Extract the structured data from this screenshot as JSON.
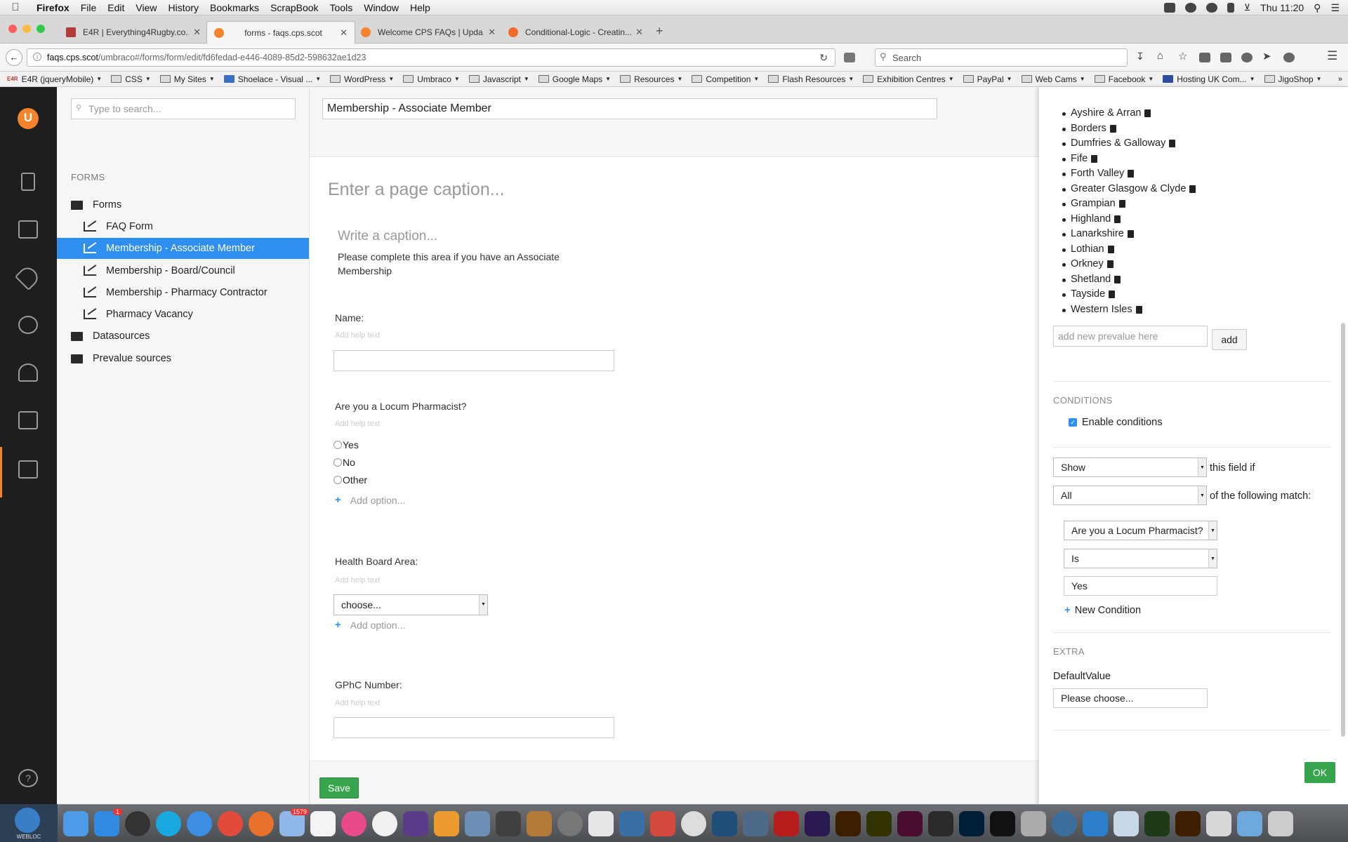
{
  "menubar": {
    "app": "Firefox",
    "items": [
      "File",
      "Edit",
      "View",
      "History",
      "Bookmarks",
      "ScrapBook",
      "Tools",
      "Window",
      "Help"
    ],
    "clock": "Thu 11:20"
  },
  "tabs": [
    {
      "label": "E4R | Everything4Rugby.co...",
      "favicon_color": "#b23b3b"
    },
    {
      "label": "forms - faqs.cps.scot",
      "favicon_color": "#f5832b"
    },
    {
      "label": "Welcome CPS FAQs | Upda...",
      "favicon_color": "#f5832b"
    },
    {
      "label": "Conditional-Logic - Creatin...",
      "favicon_color": "#f26b2b"
    }
  ],
  "url": {
    "host": "faqs.cps.scot",
    "path": "/umbraco#/forms/form/edit/fd6fedad-e446-4089-85d2-598632ae1d23"
  },
  "search_placeholder": "Search",
  "bookmarks": [
    "E4R (jqueryMobile)",
    "CSS",
    "My Sites",
    "Shoelace - Visual ...",
    "WordPress",
    "Umbraco",
    "Javascript",
    "Google Maps",
    "Resources",
    "Competition",
    "Flash Resources",
    "Exhibition Centres",
    "PayPal",
    "Web Cams",
    "Facebook",
    "Hosting UK Com...",
    "JigoShop"
  ],
  "tree": {
    "search_placeholder": "Type to search...",
    "section": "FORMS",
    "nodes": [
      {
        "label": "Forms",
        "type": "folder",
        "level": 0
      },
      {
        "label": "FAQ Form",
        "type": "form",
        "level": 1
      },
      {
        "label": "Membership - Associate Member",
        "type": "form",
        "level": 1,
        "selected": true
      },
      {
        "label": "Membership - Board/Council",
        "type": "form",
        "level": 1
      },
      {
        "label": "Membership - Pharmacy Contractor",
        "type": "form",
        "level": 1
      },
      {
        "label": "Pharmacy Vacancy",
        "type": "form",
        "level": 1
      },
      {
        "label": "Datasources",
        "type": "folder",
        "level": 0
      },
      {
        "label": "Prevalue sources",
        "type": "folder",
        "level": 0
      }
    ]
  },
  "editor": {
    "form_name": "Membership - Associate Member",
    "page_caption_placeholder": "Enter a page caption...",
    "fieldset_caption_placeholder": "Write a caption...",
    "fieldset_description": "Please complete this area if you have an Associate Membership",
    "help_placeholder": "Add help text",
    "add_option": "Add option...",
    "fields": {
      "name_label": "Name:",
      "locum_label": "Are you a Locum Pharmacist?",
      "locum_options": [
        "Yes",
        "No",
        "Other"
      ],
      "health_label": "Health Board Area:",
      "health_select": "choose...",
      "gphc_label": "GPhC Number:"
    },
    "save": "Save"
  },
  "settings": {
    "prevalues": [
      "Ayshire & Arran",
      "Borders",
      "Dumfries & Galloway",
      "Fife",
      "Forth Valley",
      "Greater Glasgow & Clyde",
      "Grampian",
      "Highland",
      "Lanarkshire",
      "Lothian",
      "Orkney",
      "Shetland",
      "Tayside",
      "Western Isles"
    ],
    "prevalue_placeholder": "add new prevalue here",
    "add": "add",
    "conditions_heading": "CONDITIONS",
    "enable_conditions": "Enable conditions",
    "action": "Show",
    "action_suffix": "this field if",
    "logic": "All",
    "logic_suffix": "of the following match:",
    "rule_field": "Are you a Locum Pharmacist?",
    "rule_operator": "Is",
    "rule_value": "Yes",
    "new_condition": "New Condition",
    "extra_heading": "EXTRA",
    "default_value_label": "DefaultValue",
    "default_value": "Please choose...",
    "ok": "OK"
  },
  "dock_badges": {
    "appstore": "1",
    "mail": "1579"
  },
  "dock_label": "WEBLOC"
}
